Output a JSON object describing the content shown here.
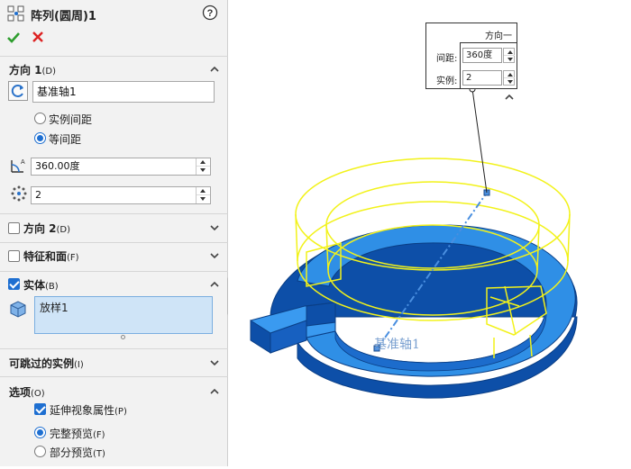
{
  "panel": {
    "title": "阵列(圆周)1",
    "help_icon": "help-icon",
    "confirm_icon": "checkmark-icon",
    "cancel_icon": "close-icon",
    "direction1": {
      "header_main": "方向 1",
      "header_key": "(D)",
      "axis_value": "基准轴1",
      "radio_instance_spacing": "实例间距",
      "radio_equal_spacing": "等间距",
      "selected_radio": "等间距",
      "angle_value": "360.00度",
      "count_value": "2"
    },
    "direction2": {
      "label": "方向 2",
      "key": "(D)",
      "checked": false
    },
    "features_faces": {
      "label": "特征和面",
      "key": "(F)",
      "checked": false
    },
    "bodies": {
      "label": "实体",
      "key": "(B)",
      "checked": true,
      "list": [
        "放样1"
      ]
    },
    "skip_instances": {
      "label": "可跳过的实例",
      "key": "(I)"
    },
    "options": {
      "label": "选项",
      "key": "(O)",
      "propagate_visual": "延伸视象属性",
      "propagate_key": "(P)",
      "propagate_checked": true,
      "full_preview": "完整预览",
      "full_preview_key": "(F)",
      "partial_preview": "部分预览",
      "partial_preview_key": "(T)",
      "selected_preview": "完整预览"
    }
  },
  "viewport": {
    "callout": {
      "title": "方向一",
      "spacing_label": "间距:",
      "spacing_value": "360度",
      "instances_label": "实例:",
      "instances_value": "2"
    },
    "axis_label": "基准轴1",
    "colors": {
      "blue_body": "#2f8fe6",
      "blue_dark": "#0d4fa8",
      "preview_yellow": "#f2f21a",
      "axis_blue": "#4a8fe0"
    }
  }
}
